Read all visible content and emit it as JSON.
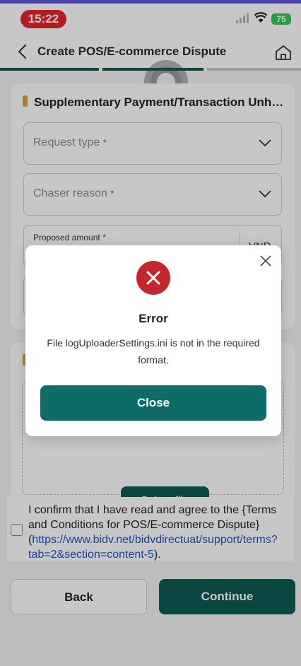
{
  "status_bar": {
    "time": "15:22",
    "battery": "75",
    "icons": [
      "signal-icon",
      "wifi-icon",
      "battery-icon"
    ]
  },
  "header": {
    "title": "Create POS/E-commerce Dispute",
    "icons": [
      "back-icon",
      "home-icon"
    ]
  },
  "stepper": {
    "total_steps": 3,
    "active_steps": 2,
    "active_color": "#0d5c57",
    "inactive_color": "#c8c8c8"
  },
  "form": {
    "section_title": "Supplementary Payment/Transaction Unh…",
    "request_type": {
      "label": "Request type",
      "required_mark": "*"
    },
    "chaser_reason": {
      "label": "Chaser reason",
      "required_mark": "*"
    },
    "proposed_amount": {
      "label": "Proposed amount",
      "required_mark": "*",
      "currency": "VND"
    }
  },
  "upload": {
    "select_file_label": "Select file"
  },
  "consent": {
    "text_before": "I confirm that I have read and agree to the {Terms and Conditions for POS/E-commerce Dispute} (",
    "link_text": "https://www.bidv.net/bidvdirectuat/support/terms?tab=2&section=content-5",
    "text_after": ").",
    "checked": false
  },
  "footer": {
    "back_label": "Back",
    "continue_label": "Continue"
  },
  "dialog": {
    "title": "Error",
    "message": "File logUploaderSettings.ini is not in the required format.",
    "close_button_label": "Close",
    "icon": "error-x-icon",
    "accent_color": "#c4262e"
  },
  "colors": {
    "primary": "#0d5c57",
    "accent_bar": "#d9a441",
    "link": "#1a57c4",
    "status_time_bg": "#e5252c"
  }
}
